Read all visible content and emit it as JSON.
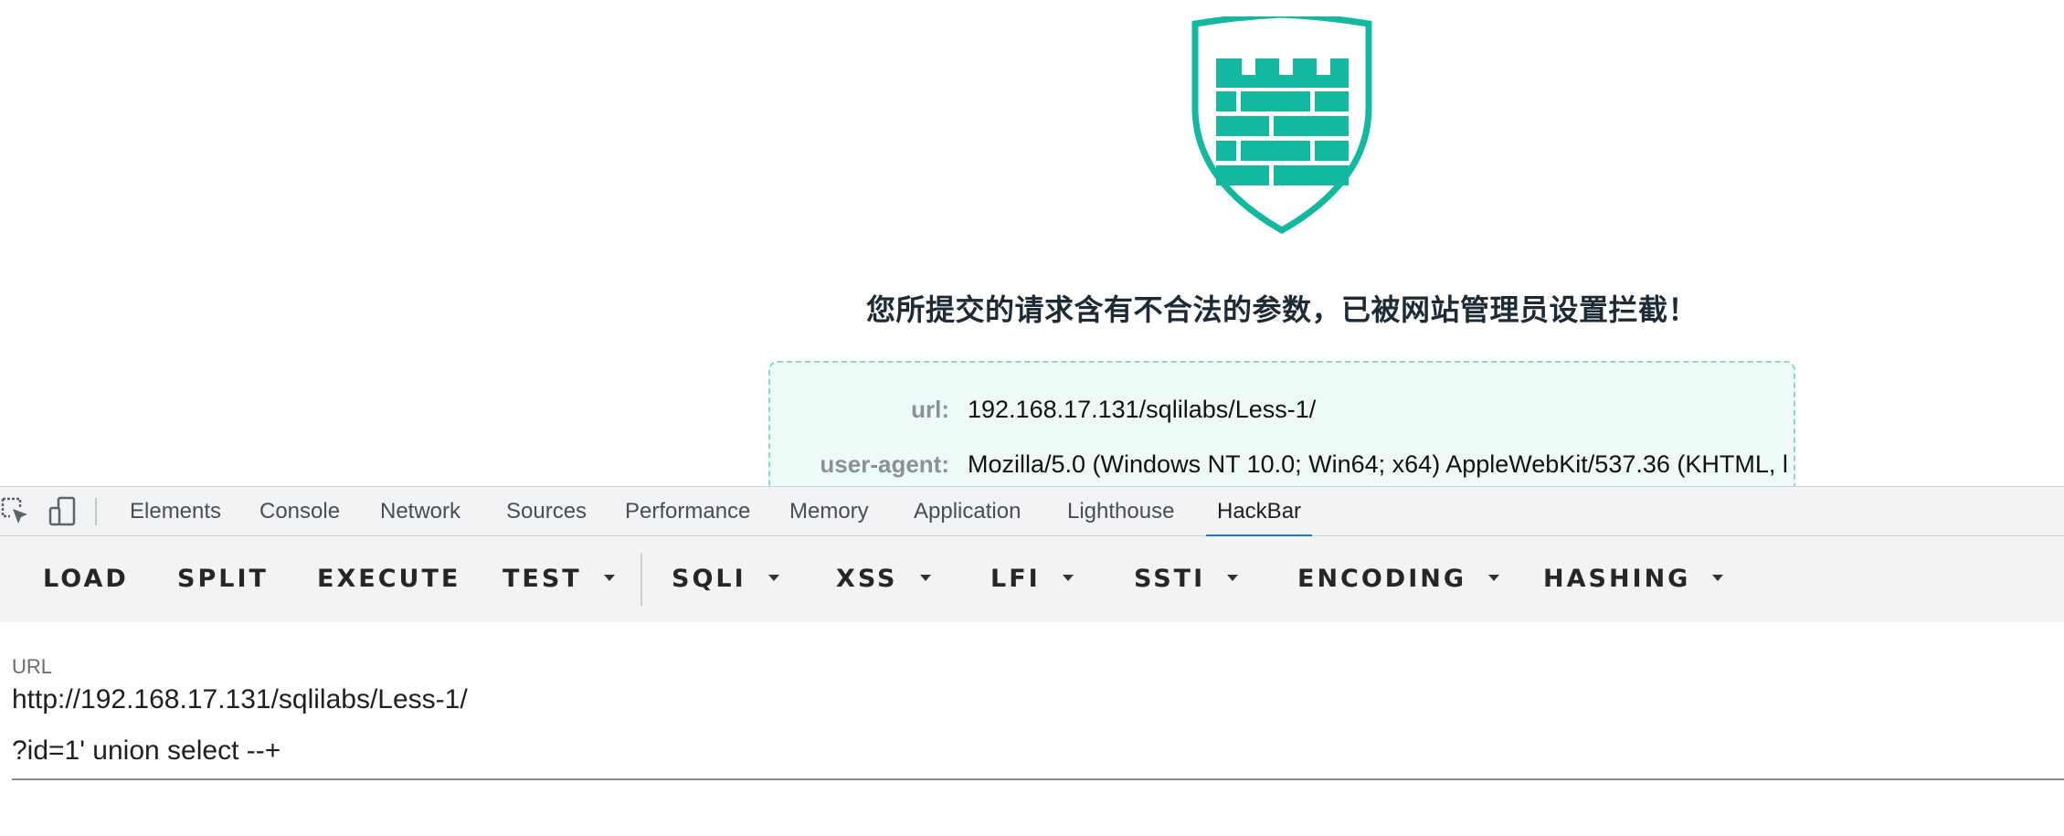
{
  "page": {
    "block_message": "您所提交的请求含有不合法的参数，已被网站管理员设置拦截！",
    "info": [
      {
        "label": "url:",
        "value": "192.168.17.131/sqlilabs/Less-1/"
      },
      {
        "label": "user-agent:",
        "value": "Mozilla/5.0 (Windows NT 10.0; Win64; x64) AppleWebKit/537.36 (KHTML, l"
      }
    ],
    "colors": {
      "shield": "#12b8a0",
      "message": "#1c2b36",
      "box_bg": "#eefaf8",
      "box_border": "#86d9cb"
    }
  },
  "devtools": {
    "icons": [
      "inspect-element-icon",
      "device-toolbar-icon"
    ],
    "tabs": [
      "Elements",
      "Console",
      "Network",
      "Sources",
      "Performance",
      "Memory",
      "Application",
      "Lighthouse",
      "HackBar"
    ],
    "active_tab": "HackBar",
    "accent": "#1a73e8"
  },
  "hackbar": {
    "buttons": {
      "load": "LOAD",
      "split": "SPLIT",
      "execute": "EXECUTE",
      "test": "TEST",
      "sqli": "SQLI",
      "xss": "XSS",
      "lfi": "LFI",
      "ssti": "SSTI",
      "encoding": "ENCODING",
      "hashing": "HASHING"
    },
    "url_label": "URL",
    "url_lines": [
      "http://192.168.17.131/sqlilabs/Less-1/",
      "?id=1' union select --+"
    ]
  }
}
